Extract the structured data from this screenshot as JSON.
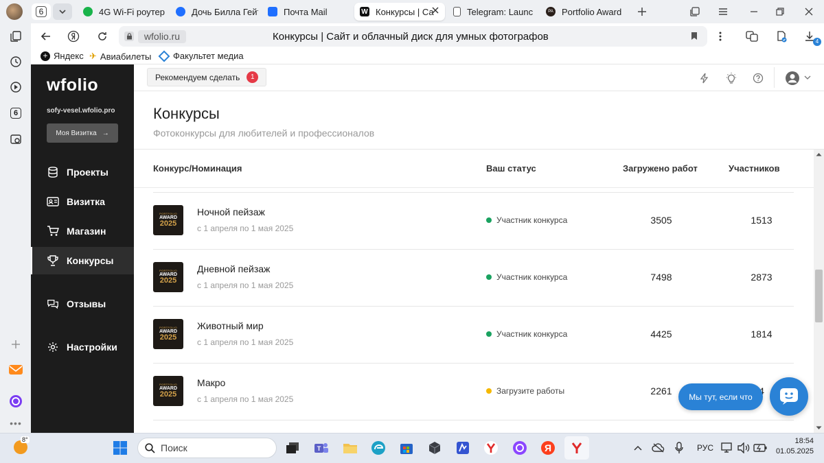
{
  "browser": {
    "tab_counter": "6",
    "tabs": [
      {
        "label": "4G Wi-Fi роутер",
        "color": "#19b34a"
      },
      {
        "label": "Дочь Билла Гейт",
        "color": "#1f6fff"
      },
      {
        "label": "Почта Mail",
        "color": "#1f6fff"
      },
      {
        "label": "Конкурсы | Са",
        "color": "#111111"
      },
      {
        "label": "Telegram: Launc",
        "color": "#ffffff"
      },
      {
        "label": "Portfolio Award",
        "color": "#2a1f1a",
        "fav_text": "PA"
      }
    ],
    "address_domain": "wfolio.ru",
    "page_title": "Конкурсы | Сайт и облачный диск для умных фотографов",
    "download_badge": "4",
    "bookmarks": [
      {
        "label": "Яндекс"
      },
      {
        "label": "Авиабилеты"
      },
      {
        "label": "Факультет медиа"
      }
    ]
  },
  "sidebar": {
    "logo": "wfolio",
    "site": "sofy-vesel.wfolio.pro",
    "card_button": "Моя Визитка",
    "items": [
      {
        "label": "Проекты",
        "icon": "database-icon",
        "active": false
      },
      {
        "label": "Визитка",
        "icon": "id-card-icon",
        "active": false
      },
      {
        "label": "Магазин",
        "icon": "cart-icon",
        "active": false
      },
      {
        "label": "Конкурсы",
        "icon": "trophy-icon",
        "active": true
      },
      {
        "label": "Отзывы",
        "icon": "chat-icon",
        "active": false
      },
      {
        "label": "Настройки",
        "icon": "gear-icon",
        "active": false
      }
    ]
  },
  "topbar": {
    "recommend_label": "Рекомендуем сделать",
    "recommend_count": "1"
  },
  "page": {
    "title": "Конкурсы",
    "subtitle": "Фотоконкурсы для любителей и профессионалов"
  },
  "table": {
    "headers": {
      "contest": "Конкурс/Номинация",
      "status": "Ваш статус",
      "uploaded": "Загружено работ",
      "participants": "Участников"
    },
    "logo_text": [
      "PORTFOLIO",
      "AWARD",
      "2025"
    ],
    "rows": [
      {
        "name": "Ночной пейзаж",
        "dates": "с 1 апреля по 1 мая 2025",
        "status": "Участник конкурса",
        "status_color": "#1aa260",
        "uploaded": "3505",
        "participants": "1513"
      },
      {
        "name": "Дневной пейзаж",
        "dates": "с 1 апреля по 1 мая 2025",
        "status": "Участник конкурса",
        "status_color": "#1aa260",
        "uploaded": "7498",
        "participants": "2873"
      },
      {
        "name": "Животный мир",
        "dates": "с 1 апреля по 1 мая 2025",
        "status": "Участник конкурса",
        "status_color": "#1aa260",
        "uploaded": "4425",
        "participants": "1814"
      },
      {
        "name": "Макро",
        "dates": "с 1 апреля по 1 мая 2025",
        "status": "Загрузите работы",
        "status_color": "#f5b800",
        "uploaded": "2261",
        "participants": "4"
      }
    ]
  },
  "chat": {
    "bubble": "Мы тут, если что"
  },
  "taskbar": {
    "weather": "8°",
    "search_placeholder": "Поиск",
    "lang": "РУС",
    "time": "18:54",
    "date": "01.05.2025"
  },
  "colors": {
    "sidebar_bg": "#1c1c1c",
    "accent_blue": "#2a82d6",
    "badge_red": "#e53946"
  }
}
